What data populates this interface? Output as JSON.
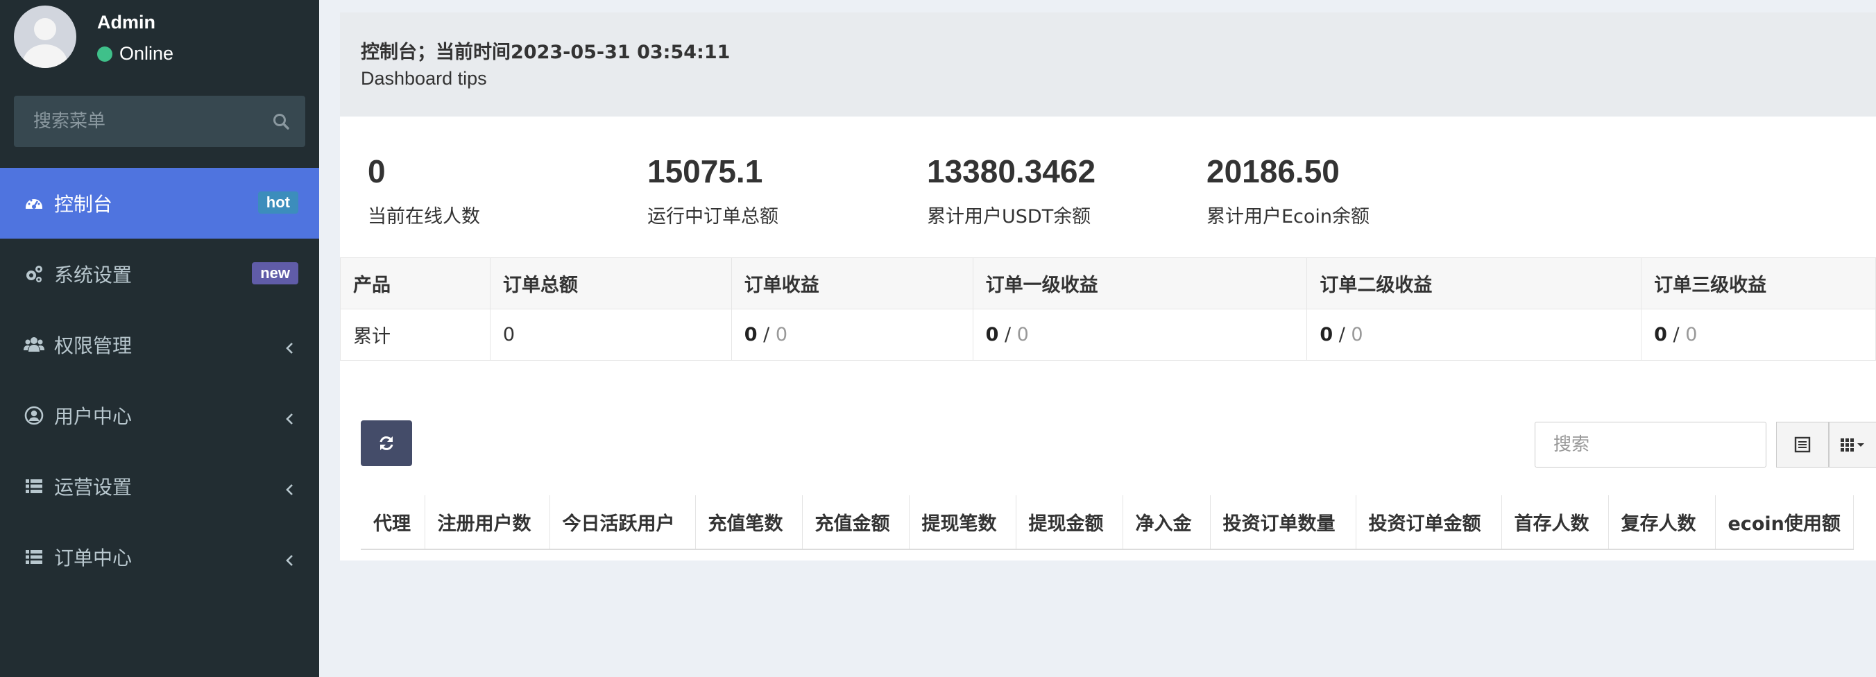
{
  "user": {
    "name": "Admin",
    "status": "Online",
    "status_color": "#3fc08a"
  },
  "sidebar": {
    "search_placeholder": "搜索菜单",
    "items": [
      {
        "label": "控制台",
        "icon": "dashboard-icon",
        "badge": "hot",
        "active": true
      },
      {
        "label": "系统设置",
        "icon": "cogs-icon",
        "badge": "new"
      },
      {
        "label": "权限管理",
        "icon": "users-icon"
      },
      {
        "label": "用户中心",
        "icon": "user-circle-icon"
      },
      {
        "label": "运营设置",
        "icon": "list-icon"
      },
      {
        "label": "订单中心",
        "icon": "list-icon"
      }
    ]
  },
  "header": {
    "title": "控制台；当前时间2023-05-31 03:54:11",
    "tips": "Dashboard tips"
  },
  "stats": [
    {
      "value": "0",
      "label": "当前在线人数"
    },
    {
      "value": "15075.1",
      "label": "运行中订单总额"
    },
    {
      "value": "13380.3462",
      "label": "累计用户USDT余额"
    },
    {
      "value": "20186.50",
      "label": "累计用户Ecoin余额"
    }
  ],
  "income_table": {
    "headers": [
      "产品",
      "订单总额",
      "订单收益",
      "订单一级收益",
      "订单二级收益",
      "订单三级收益"
    ],
    "row": {
      "product": "累计",
      "total": "0",
      "cells": [
        {
          "a": "0",
          "sep": " / ",
          "b": "0"
        },
        {
          "a": "0",
          "sep": " / ",
          "b": "0"
        },
        {
          "a": "0",
          "sep": " / ",
          "b": "0"
        },
        {
          "a": "0",
          "sep": " / ",
          "b": "0"
        }
      ]
    }
  },
  "toolbar": {
    "search_placeholder": "搜索"
  },
  "data_table": {
    "columns": [
      "代理",
      "注册用户数",
      "今日活跃用户",
      "充值笔数",
      "充值金额",
      "提现笔数",
      "提现金额",
      "净入金",
      "投资订单数量",
      "投资订单金额",
      "首存人数",
      "复存人数",
      "ecoin使用额"
    ]
  },
  "colors": {
    "sidebar_bg": "#222d32",
    "active_bg": "#4f74df",
    "hot_badge": "#3c8dbc",
    "new_badge": "#605ca8",
    "refresh_btn": "#444c69"
  }
}
